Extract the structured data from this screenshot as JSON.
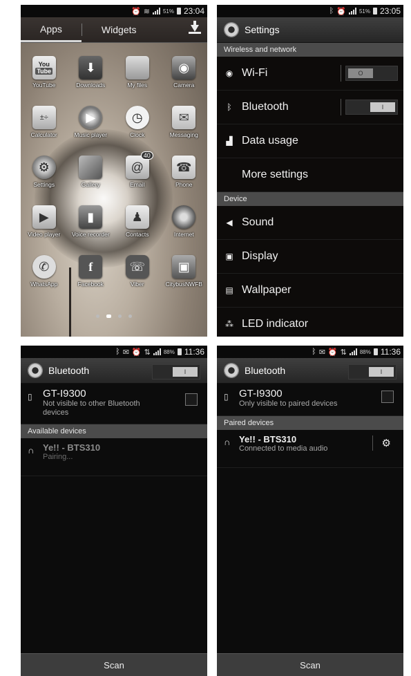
{
  "screen1": {
    "status_time": "23:04",
    "battery": "51%",
    "tabs": [
      "Apps",
      "Widgets"
    ],
    "apps": [
      {
        "label": "YouTube",
        "icon": "youtube-icon"
      },
      {
        "label": "Downloads",
        "icon": "download-icon"
      },
      {
        "label": "My files",
        "icon": "folder-icon"
      },
      {
        "label": "Camera",
        "icon": "camera-icon"
      },
      {
        "label": "Calculator",
        "icon": "calculator-icon"
      },
      {
        "label": "Music player",
        "icon": "music-icon"
      },
      {
        "label": "Clock",
        "icon": "clock-icon"
      },
      {
        "label": "Messaging",
        "icon": "envelope-icon"
      },
      {
        "label": "Settings",
        "icon": "gear-icon"
      },
      {
        "label": "Gallery",
        "icon": "gallery-icon"
      },
      {
        "label": "Email",
        "icon": "email-icon",
        "badge": "40"
      },
      {
        "label": "Phone",
        "icon": "phone-icon"
      },
      {
        "label": "Video player",
        "icon": "video-icon"
      },
      {
        "label": "Voice recorder",
        "icon": "microphone-icon"
      },
      {
        "label": "Contacts",
        "icon": "contacts-icon"
      },
      {
        "label": "Internet",
        "icon": "globe-icon"
      },
      {
        "label": "WhatsApp",
        "icon": "whatsapp-icon"
      },
      {
        "label": "Facebook",
        "icon": "facebook-icon"
      },
      {
        "label": "Viber",
        "icon": "viber-icon"
      },
      {
        "label": "CitybusNWFB",
        "icon": "bus-icon"
      }
    ],
    "youtube_top": "You",
    "youtube_bottom": "Tube",
    "facebook_glyph": "f"
  },
  "screen2": {
    "status_time": "23:05",
    "battery": "51%",
    "title": "Settings",
    "section1": "Wireless and network",
    "wifi": "Wi-Fi",
    "wifi_state": "O",
    "bluetooth": "Bluetooth",
    "bluetooth_state": "I",
    "data_usage": "Data usage",
    "more_settings": "More settings",
    "section2": "Device",
    "sound": "Sound",
    "display": "Display",
    "wallpaper": "Wallpaper",
    "led": "LED indicator"
  },
  "screen3": {
    "status_time": "11:36",
    "battery": "88%",
    "title": "Bluetooth",
    "toggle_state": "I",
    "device_name": "GT-I9300",
    "device_sub": "Not visible to other Bluetooth devices",
    "section": "Available devices",
    "pair_name": "Ye!! - BTS310",
    "pair_sub": "Pairing...",
    "scan": "Scan"
  },
  "screen4": {
    "status_time": "11:36",
    "battery": "88%",
    "title": "Bluetooth",
    "toggle_state": "I",
    "device_name": "GT-I9300",
    "device_sub": "Only visible to paired devices",
    "section": "Paired devices",
    "pair_name": "Ye!! - BTS310",
    "pair_sub": "Connected to media audio",
    "scan": "Scan"
  },
  "colors": {
    "background": "#0d0b0a",
    "section_header": "#4b4b4b",
    "scan_bar": "#3d3d3d"
  }
}
